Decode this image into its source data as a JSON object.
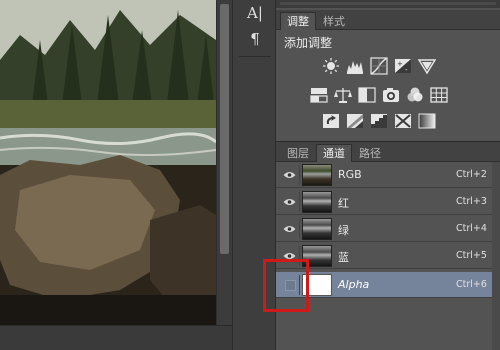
{
  "side_dock": {
    "character_icon_glyph": "A|",
    "paragraph_icon_glyph": "¶"
  },
  "adjustments_panel": {
    "tabs": [
      {
        "label": "调整",
        "active": true
      },
      {
        "label": "样式",
        "active": false
      }
    ],
    "title": "添加调整",
    "icon_rows": [
      [
        "brightness-contrast-icon",
        "levels-icon",
        "curves-icon",
        "exposure-icon",
        "vibrance-icon"
      ],
      [
        "hue-saturation-icon",
        "color-balance-icon",
        "black-white-icon",
        "photo-filter-icon",
        "channel-mixer-icon",
        "color-lookup-icon"
      ],
      [
        "invert-icon",
        "posterize-icon",
        "threshold-icon",
        "selective-color-icon",
        "gradient-map-icon"
      ]
    ]
  },
  "channels_panel": {
    "tabs": [
      {
        "label": "图层",
        "active": false
      },
      {
        "label": "通道",
        "active": true
      },
      {
        "label": "路径",
        "active": false
      }
    ],
    "rows": [
      {
        "name": "RGB",
        "shortcut": "Ctrl+2",
        "visible": true,
        "thumb": "color",
        "selected": false
      },
      {
        "name": "红",
        "shortcut": "Ctrl+3",
        "visible": true,
        "thumb": "gray",
        "selected": false
      },
      {
        "name": "绿",
        "shortcut": "Ctrl+4",
        "visible": true,
        "thumb": "gray",
        "selected": false
      },
      {
        "name": "蓝",
        "shortcut": "Ctrl+5",
        "visible": true,
        "thumb": "gray",
        "selected": false
      },
      {
        "name": "Alpha",
        "shortcut": "Ctrl+6",
        "visible": false,
        "thumb": "white",
        "selected": true
      }
    ]
  },
  "colors": {
    "panel_bg": "#535353",
    "selected_row": "#75849a",
    "highlight_annotation": "#d01a1a"
  }
}
